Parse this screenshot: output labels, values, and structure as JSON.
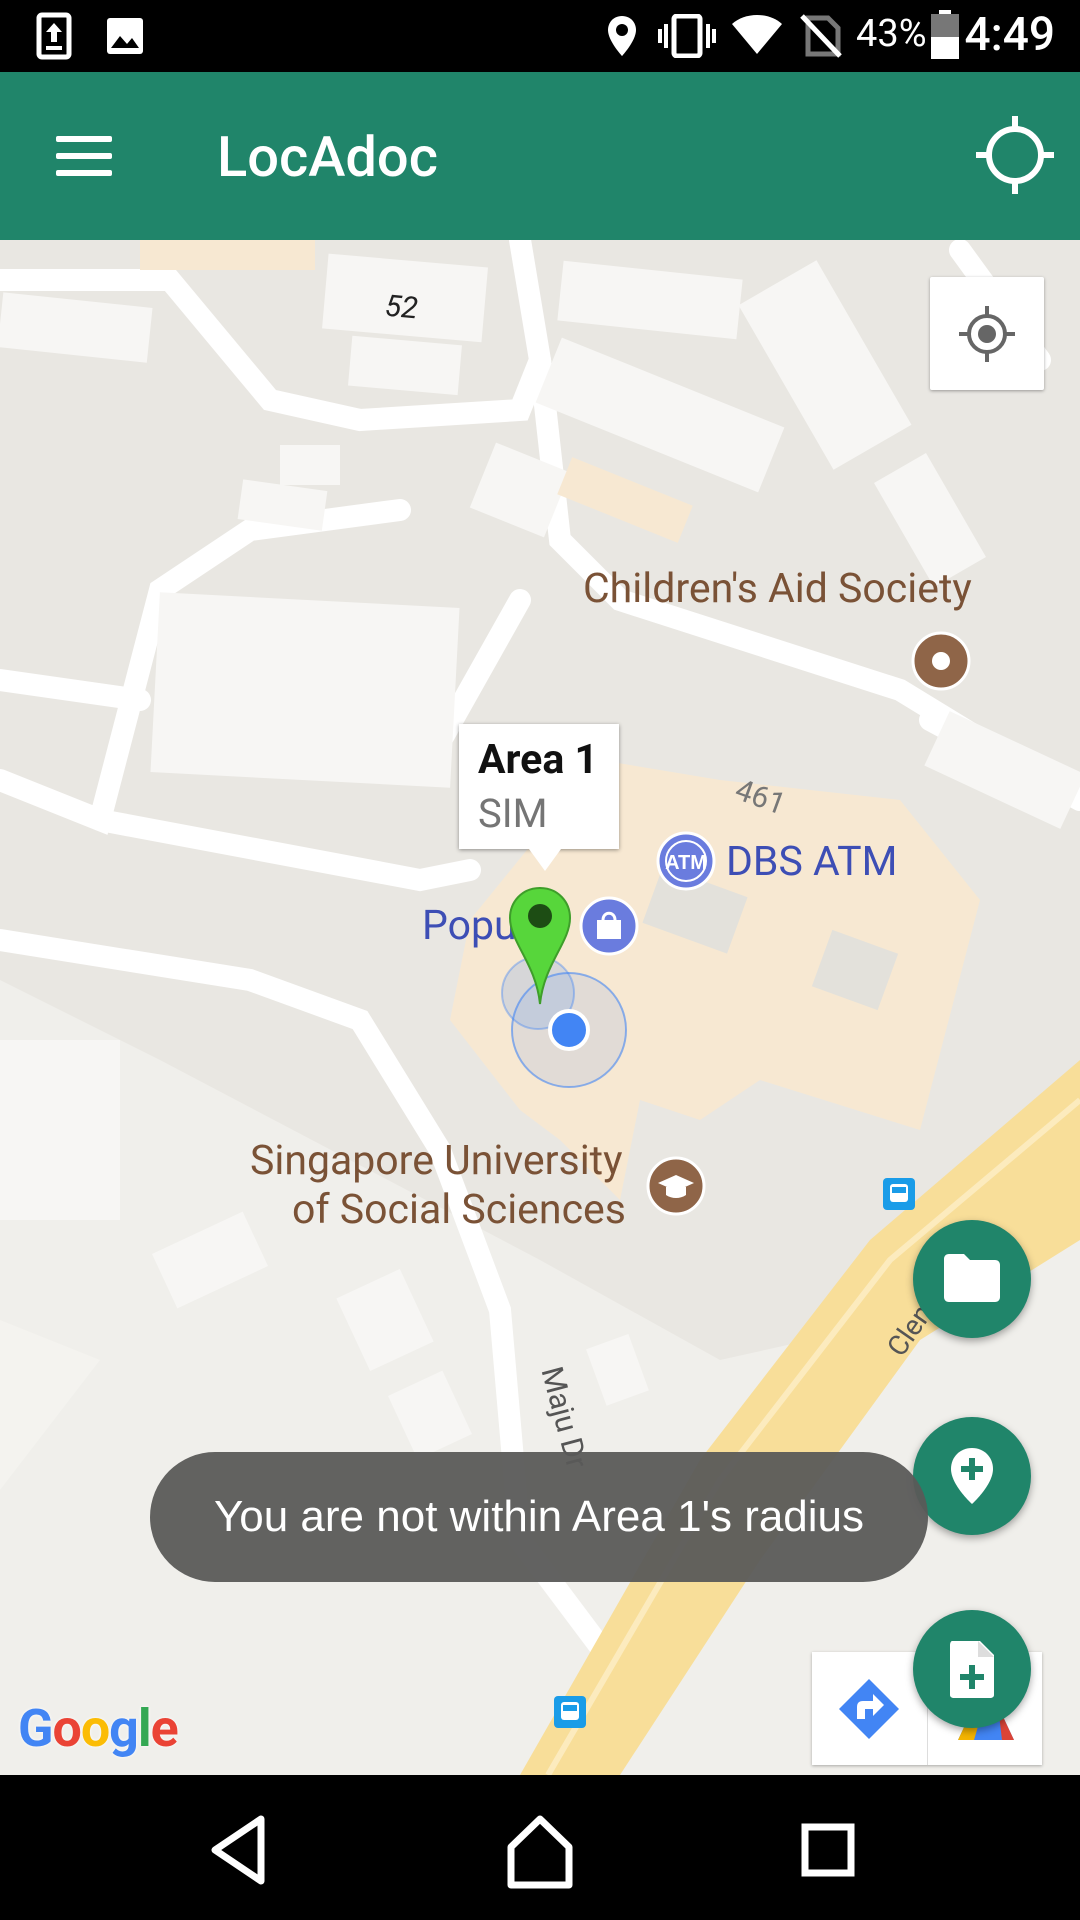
{
  "status_bar": {
    "battery_percent": "43%",
    "time": "4:49",
    "icons": [
      "upload-icon",
      "image-icon",
      "location-icon",
      "vibrate-icon",
      "wifi-icon",
      "no-sim-icon",
      "battery-icon"
    ]
  },
  "app_bar": {
    "title": "LocAdoc",
    "menu_icon": "hamburger-menu-icon",
    "action_icon": "gps-target-icon"
  },
  "map": {
    "labels": {
      "building_52": "52",
      "building_461": "461",
      "childrens_aid": "Children's Aid Society",
      "dbs_atm": "DBS ATM",
      "popular_partial": "Popu",
      "suss_line1": "Singapore University",
      "suss_line2": "of Social Sciences",
      "maju_dr": "Maju Dr",
      "clementi_partial": "Clem",
      "atm_badge": "ATM"
    },
    "marker_info": {
      "title": "Area 1",
      "snippet": "SIM"
    },
    "marker_color": "#57D63B",
    "my_location_color": "#4285F4",
    "attribution": "Google"
  },
  "fabs": {
    "folder": "folder-icon",
    "add_location": "add-location-icon",
    "add_document": "add-document-icon"
  },
  "toast": {
    "message": "You are not within Area 1's radius"
  },
  "colors": {
    "primary": "#20856A",
    "toast_bg": "#5A5A58"
  },
  "nav_bar": {
    "icons": [
      "back-icon",
      "home-icon",
      "recents-icon"
    ]
  }
}
